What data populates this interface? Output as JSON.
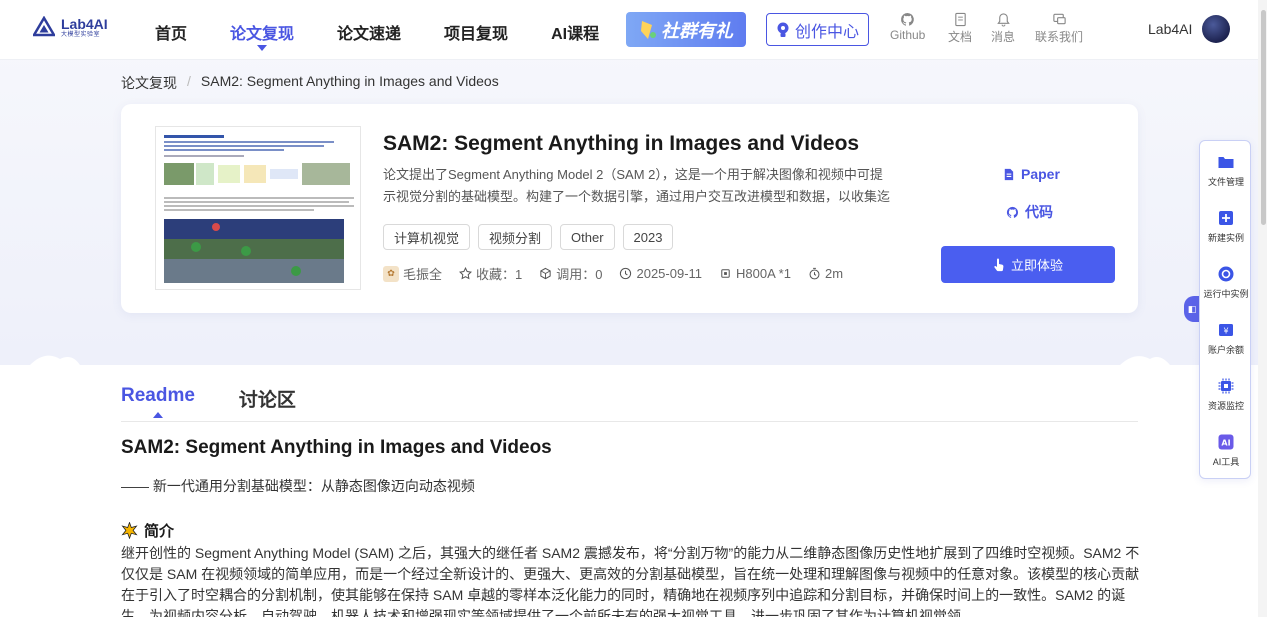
{
  "header": {
    "logo_name": "Lab4AI",
    "logo_sub": "大模型实验室",
    "nav": [
      "首页",
      "论文复现",
      "论文速递",
      "项目复现",
      "AI课程"
    ],
    "promo_label": "社群有礼",
    "create_label": "创作中心",
    "tools": [
      "Github",
      "文档",
      "消息",
      "联系我们"
    ],
    "user_name": "Lab4AI"
  },
  "breadcrumb": {
    "root": "论文复现",
    "current": "SAM2: Segment Anything in Images and Videos"
  },
  "paper": {
    "title": "SAM2: Segment Anything in Images and Videos",
    "description": "论文提出了Segment Anything Model 2（SAM 2），这是一个用于解决图像和视频中可提示视觉分割的基础模型。构建了一个数据引擎，通过用户交互改进模型和数据，以收集迄今…",
    "tags": [
      "计算机视觉",
      "视频分割",
      "Other",
      "2023"
    ],
    "author": "毛振全",
    "favorites": "收藏：1",
    "calls": "调用：0",
    "date": "2025-09-11",
    "gpu": "H800A *1",
    "duration": "2m",
    "paper_link": "Paper",
    "code_link": "代码",
    "try_label": "立即体验"
  },
  "tabs": [
    "Readme",
    "讨论区"
  ],
  "readme": {
    "title": "SAM2: Segment Anything in Images and Videos",
    "subtitle": "—— 新一代通用分割基础模型：从静态图像迈向动态视频",
    "section_title": "简介",
    "body": "继开创性的 Segment Anything Model (SAM) 之后，其强大的继任者 SAM2 震撼发布，将“分割万物”的能力从二维静态图像历史性地扩展到了四维时空视频。SAM2 不仅仅是 SAM 在视频领域的简单应用，而是一个经过全新设计的、更强大、更高效的分割基础模型，旨在统一处理和理解图像与视频中的任意对象。该模型的核心贡献在于引入了时空耦合的分割机制，使其能够在保持 SAM 卓越的零样本泛化能力的同时，精确地在视频序列中追踪和分割目标，并确保时间上的一致性。SAM2 的诞生，为视频内容分析、自动驾驶、机器人技术和增强现实等领域提供了一个前所未有的强大视觉工具，进一步巩固了其作为计算机视觉领"
  },
  "float_panel": [
    "文件管理",
    "新建实例",
    "运行中实例",
    "账户余额",
    "资源监控",
    "AI工具"
  ],
  "colors": {
    "accent": "#4a56e2",
    "button": "#4a5ef0"
  }
}
